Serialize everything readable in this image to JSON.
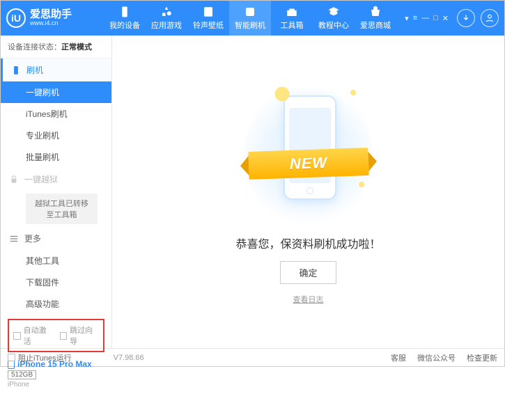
{
  "brand": {
    "name": "爱思助手",
    "url": "www.i4.cn",
    "logo_letter": "iU"
  },
  "sys": [
    "▾",
    "≡",
    "—",
    "□",
    "✕"
  ],
  "topnav": [
    {
      "label": "我的设备"
    },
    {
      "label": "应用游戏"
    },
    {
      "label": "铃声壁纸"
    },
    {
      "label": "智能刷机"
    },
    {
      "label": "工具箱"
    },
    {
      "label": "教程中心"
    },
    {
      "label": "爱思商城"
    }
  ],
  "status": {
    "label": "设备连接状态：",
    "value": "正常模式"
  },
  "section_flash": "刷机",
  "flash_items": [
    "一键刷机",
    "iTunes刷机",
    "专业刷机",
    "批量刷机"
  ],
  "section_jailbreak": "一键越狱",
  "jailbreak_note": "越狱工具已转移至工具箱",
  "section_more": "更多",
  "more_items": [
    "其他工具",
    "下载固件",
    "高级功能"
  ],
  "checks": {
    "auto_activate": "自动激活",
    "skip_guide": "跳过向导"
  },
  "device": {
    "name": "iPhone 15 Pro Max",
    "storage": "512GB",
    "type": "iPhone"
  },
  "main": {
    "ribbon": "NEW",
    "message": "恭喜您，保资料刷机成功啦！",
    "ok": "确定",
    "log": "查看日志"
  },
  "footer": {
    "block_itunes": "阻止iTunes运行",
    "version": "V7.98.66",
    "links": [
      "客服",
      "微信公众号",
      "检查更新"
    ]
  }
}
